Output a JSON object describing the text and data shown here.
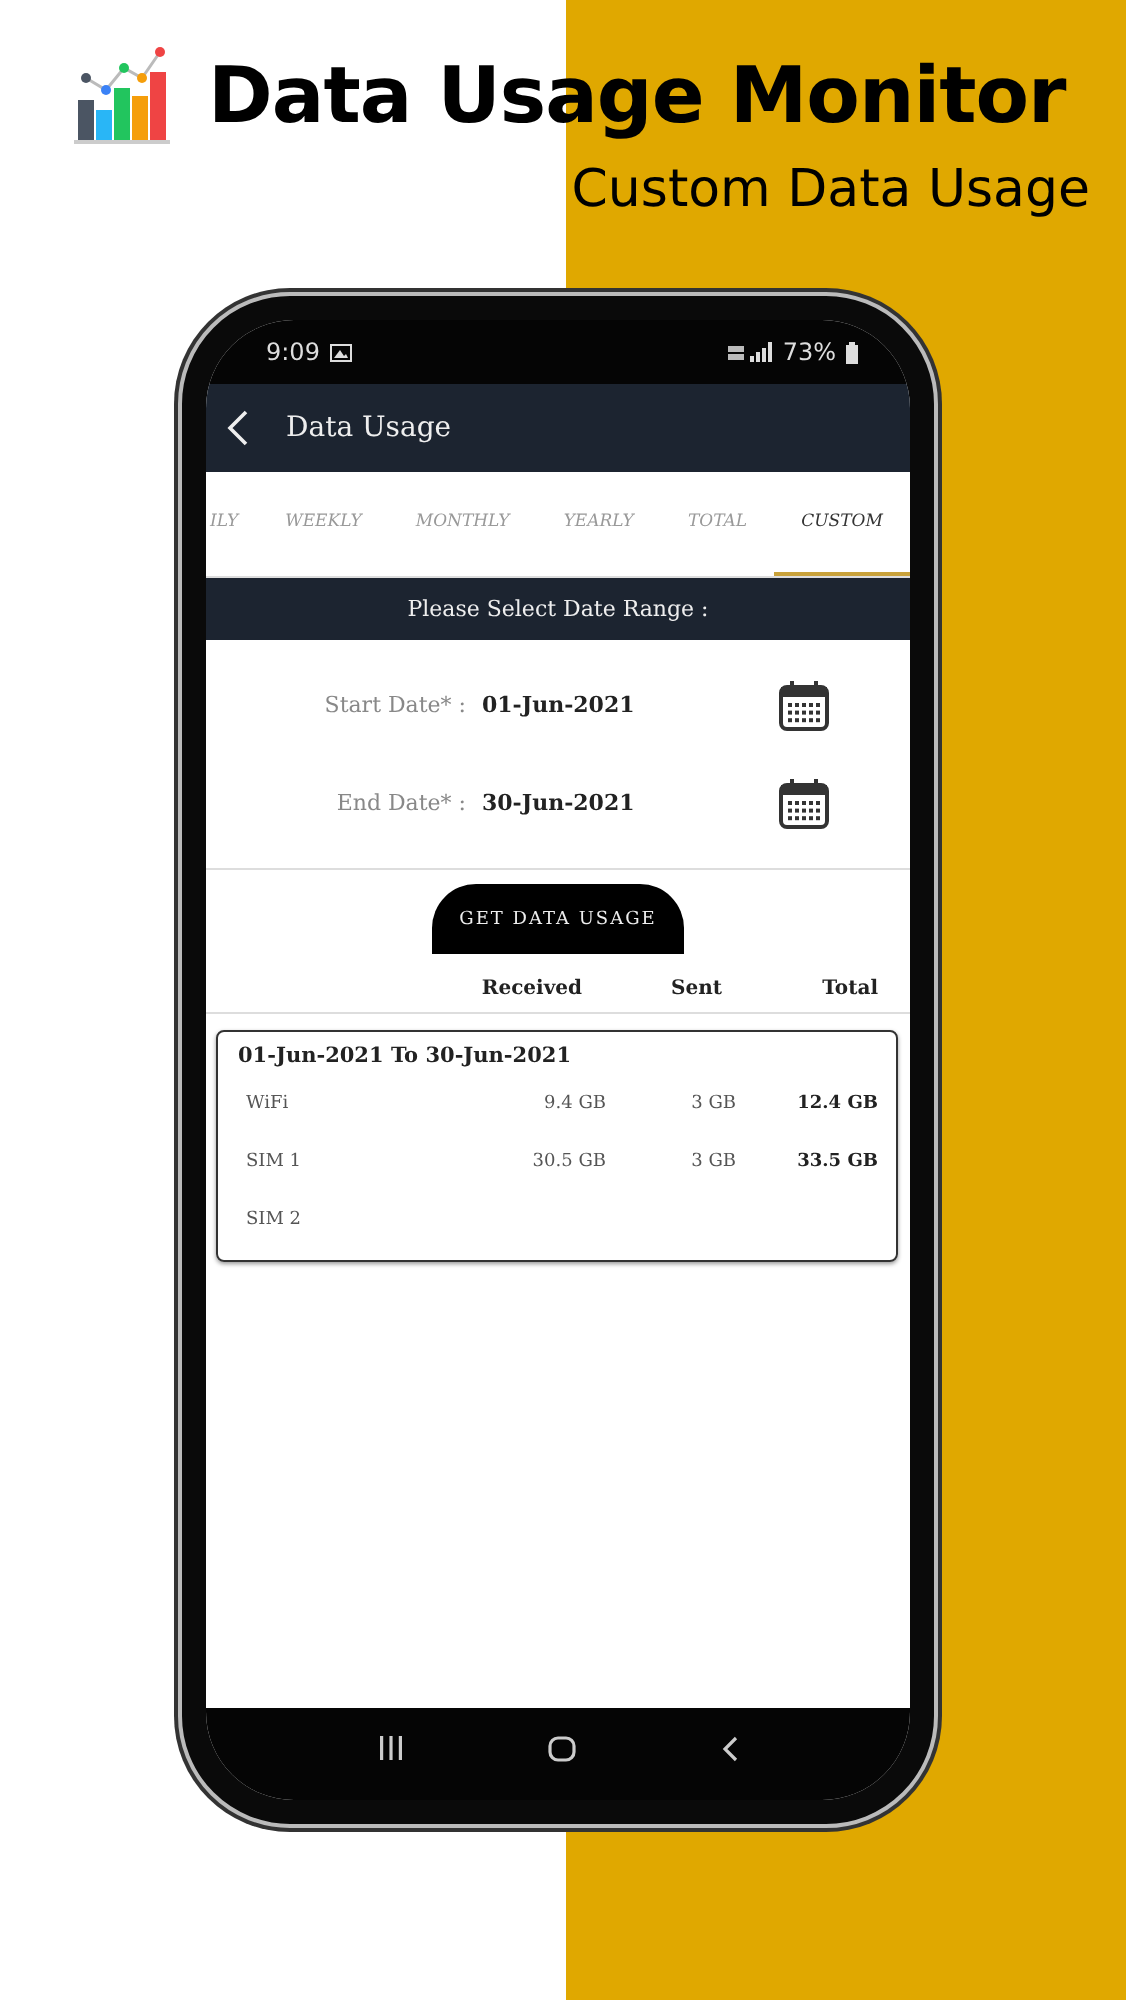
{
  "header": {
    "title": "Data Usage Monitor",
    "subtitle": "Custom Data Usage"
  },
  "status_bar": {
    "time": "9:09",
    "battery": "73%"
  },
  "app_bar": {
    "title": "Data Usage"
  },
  "tabs": [
    {
      "label": "ILY",
      "selected": false
    },
    {
      "label": "WEEKLY",
      "selected": false
    },
    {
      "label": "MONTHLY",
      "selected": false
    },
    {
      "label": "YEARLY",
      "selected": false
    },
    {
      "label": "TOTAL",
      "selected": false
    },
    {
      "label": "CUSTOM",
      "selected": true
    }
  ],
  "banner": "Please Select Date Range :",
  "dates": [
    {
      "label": "Start Date* :",
      "value": "01-Jun-2021"
    },
    {
      "label": "End Date* :",
      "value": "30-Jun-2021"
    }
  ],
  "action_button": "GET DATA USAGE",
  "columns": [
    "Received",
    "Sent",
    "Total"
  ],
  "card": {
    "title": "01-Jun-2021 To 30-Jun-2021",
    "rows": [
      {
        "name": "WiFi",
        "received": "9.4 GB",
        "sent": "3 GB",
        "total": "12.4 GB"
      },
      {
        "name": "SIM 1",
        "received": "30.5 GB",
        "sent": "3 GB",
        "total": "33.5 GB"
      },
      {
        "name": "SIM 2"
      }
    ]
  }
}
